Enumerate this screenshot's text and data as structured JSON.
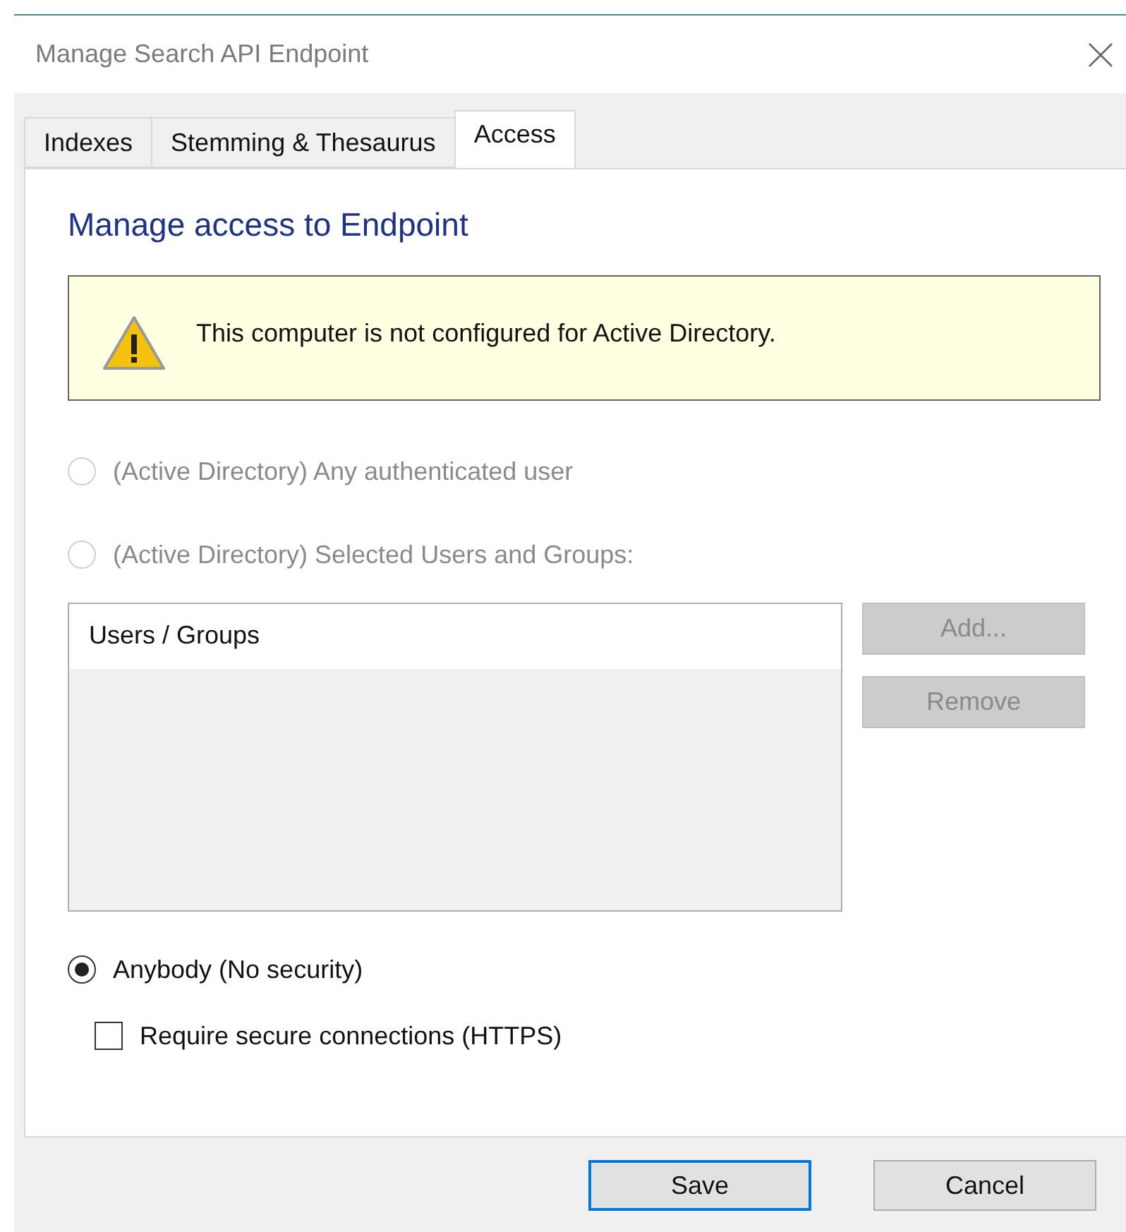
{
  "window": {
    "title": "Manage Search API Endpoint"
  },
  "tabs": [
    {
      "label": "Indexes",
      "selected": false
    },
    {
      "label": "Stemming & Thesaurus",
      "selected": false
    },
    {
      "label": "Access",
      "selected": true
    }
  ],
  "heading": "Manage access to Endpoint",
  "warning": {
    "text": "This computer is not configured for Active Directory."
  },
  "access_options": [
    {
      "label": "(Active Directory) Any authenticated user",
      "selected": false,
      "disabled": true
    },
    {
      "label": "(Active Directory) Selected Users and Groups:",
      "selected": false,
      "disabled": true
    }
  ],
  "users_list": {
    "columns": [
      "Users / Groups"
    ]
  },
  "list_buttons": [
    {
      "label": "Add...",
      "disabled": true
    },
    {
      "label": "Remove",
      "disabled": true
    }
  ],
  "anybody_option": {
    "label": "Anybody (No security)",
    "selected": true,
    "disabled": false
  },
  "https_checkbox": {
    "label": "Require secure connections (HTTPS)",
    "checked": false
  },
  "footer_buttons": [
    {
      "label": "Save",
      "default": true
    },
    {
      "label": "Cancel",
      "default": false
    }
  ]
}
